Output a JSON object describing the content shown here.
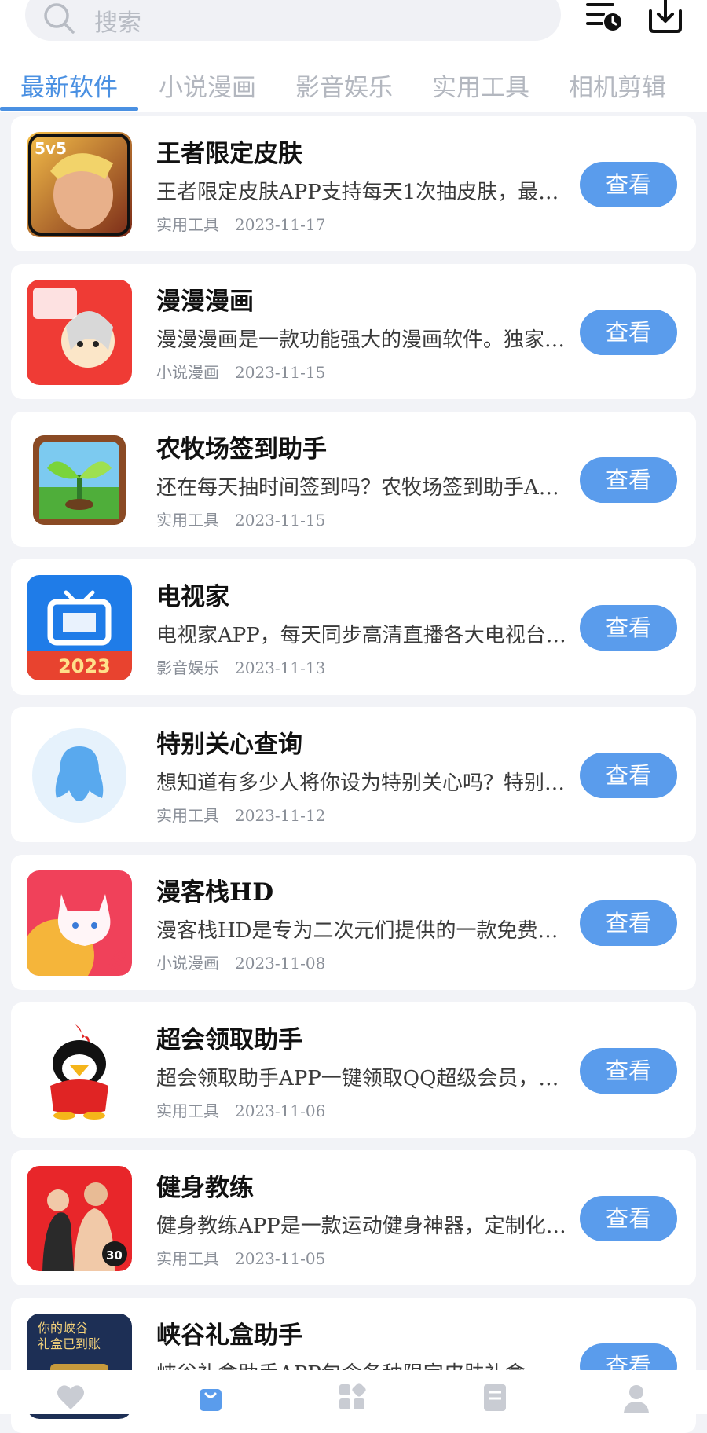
{
  "search": {
    "placeholder": "搜索"
  },
  "header_icons": {
    "history": "list-clock-icon",
    "download": "download-icon"
  },
  "tabs": [
    {
      "label": "最新软件",
      "active": true
    },
    {
      "label": "小说漫画",
      "active": false
    },
    {
      "label": "影音娱乐",
      "active": false
    },
    {
      "label": "实用工具",
      "active": false
    },
    {
      "label": "相机剪辑",
      "active": false
    }
  ],
  "colors": {
    "accent": "#4a90e2",
    "button": "#5a9cec",
    "background": "#f2f3f7"
  },
  "apps": [
    {
      "title": "王者限定皮肤",
      "desc": "王者限定皮肤APP支持每天1次抽皮肤，最…",
      "category": "实用工具",
      "date": "2023-11-17",
      "button": "查看",
      "icon": "hero-game-icon"
    },
    {
      "title": "漫漫漫画",
      "desc": "漫漫漫画是一款功能强大的漫画软件。独家…",
      "category": "小说漫画",
      "date": "2023-11-15",
      "button": "查看",
      "icon": "manga-icon"
    },
    {
      "title": "农牧场签到助手",
      "desc": "还在每天抽时间签到吗？农牧场签到助手A…",
      "category": "实用工具",
      "date": "2023-11-15",
      "button": "查看",
      "icon": "sprout-icon"
    },
    {
      "title": "电视家",
      "desc": "电视家APP，每天同步高清直播各大电视台…",
      "category": "影音娱乐",
      "date": "2023-11-13",
      "button": "查看",
      "icon": "tv-icon"
    },
    {
      "title": "特别关心查询",
      "desc": "想知道有多少人将你设为特别关心吗？特别…",
      "category": "实用工具",
      "date": "2023-11-12",
      "button": "查看",
      "icon": "penguin-outline-icon"
    },
    {
      "title": "漫客栈HD",
      "desc": "漫客栈HD是专为二次元们提供的一款免费…",
      "category": "小说漫画",
      "date": "2023-11-08",
      "button": "查看",
      "icon": "cat-icon"
    },
    {
      "title": "超会领取助手",
      "desc": "超会领取助手APP一键领取QQ超级会员，…",
      "category": "实用工具",
      "date": "2023-11-06",
      "button": "查看",
      "icon": "qq-penguin-icon"
    },
    {
      "title": "健身教练",
      "desc": "健身教练APP是一款运动健身神器，定制化…",
      "category": "实用工具",
      "date": "2023-11-05",
      "button": "查看",
      "icon": "fitness-icon"
    },
    {
      "title": "峡谷礼盒助手",
      "desc": "峡谷礼盒助手APP包含各种限定皮肤礼盒…",
      "category": "",
      "date": "",
      "button": "查看",
      "icon": "gift-box-icon",
      "logo_text": [
        "你的峡谷",
        "礼盒已到账"
      ]
    }
  ],
  "bottom_nav": [
    {
      "icon": "heart-icon",
      "active": false
    },
    {
      "icon": "bag-icon",
      "active": true
    },
    {
      "icon": "apps-grid-icon",
      "active": false
    },
    {
      "icon": "document-icon",
      "active": false
    },
    {
      "icon": "user-icon",
      "active": false
    }
  ]
}
